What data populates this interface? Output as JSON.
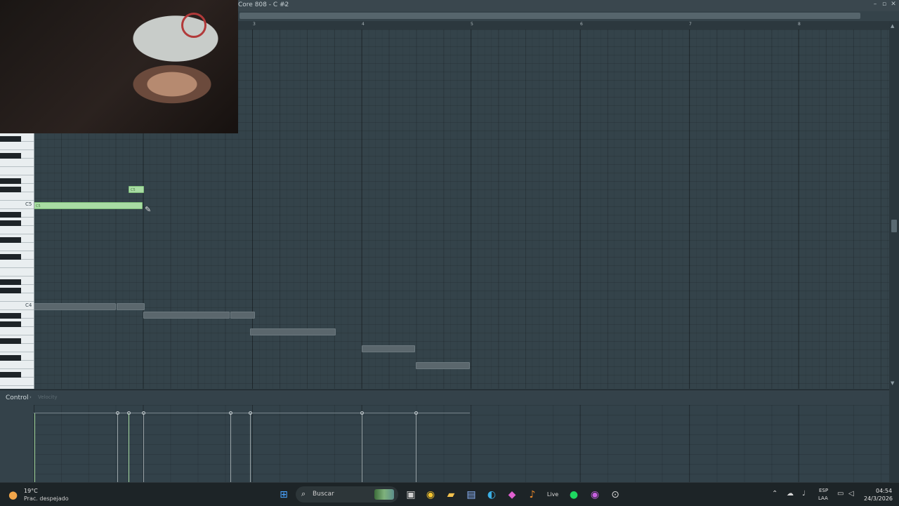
{
  "window": {
    "title": "Core 808 - C #2",
    "title_arrow": "›",
    "controls": [
      "–",
      "▫",
      "✕"
    ]
  },
  "ruler": {
    "bars": [
      "3",
      "4",
      "5",
      "6",
      "7",
      "8"
    ]
  },
  "piano_roll": {
    "octave_labels": [
      "C5",
      "C4"
    ],
    "selected_note_label": "C5"
  },
  "control_panel": {
    "label": "Control",
    "arrow": "›",
    "param": "Velocity"
  },
  "taskbar": {
    "weather_temp": "19°C",
    "weather_desc": "Prac. despejado",
    "search_placeholder": "Buscar",
    "lang_top": "ESP",
    "lang_bottom": "LAA",
    "time": "04:54",
    "date": "24/3/2026"
  },
  "colors": {
    "selected_note": "#a8dca3",
    "ghost_note": "#5b676d",
    "grid_bg": "#34434a"
  }
}
